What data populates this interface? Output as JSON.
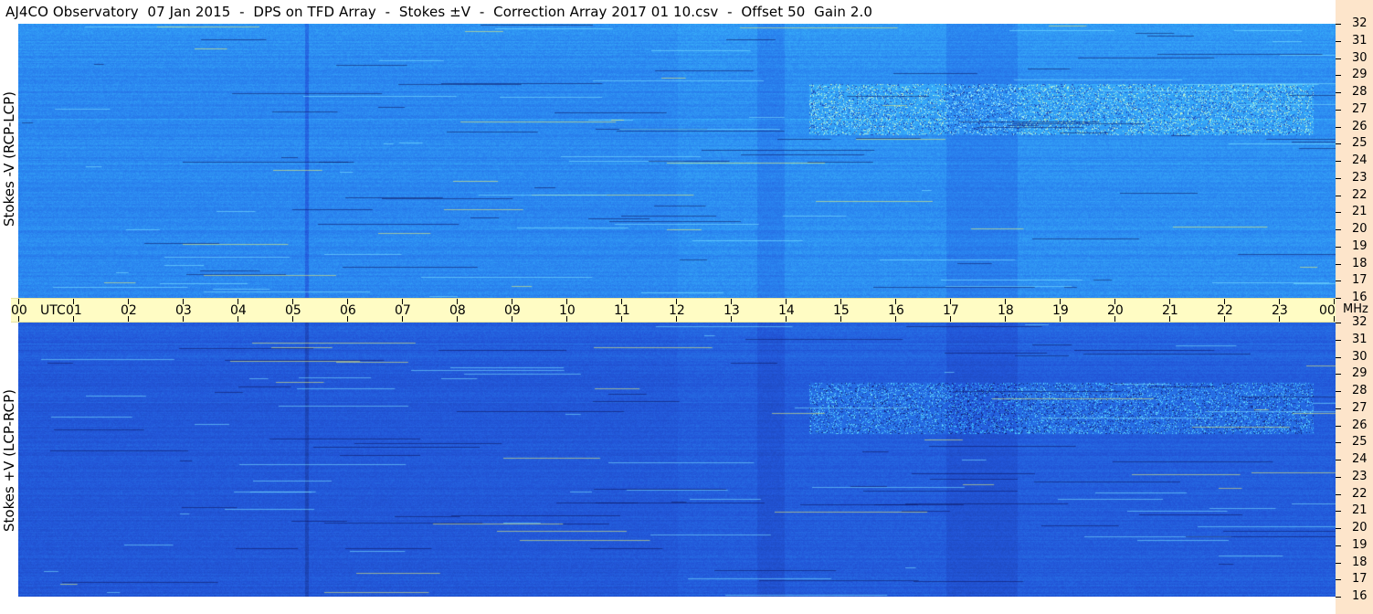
{
  "title": "AJ4CO Observatory  07 Jan 2015  -  DPS on TFD Array  -  Stokes ±V  -  Correction Array 2017 01 10.csv  -  Offset 50  Gain 2.0",
  "chart_data": [
    {
      "type": "heatmap",
      "panel": "top",
      "ylabel": "Stokes -V (RCP-LCP)",
      "x_ticks": [
        "00",
        "01",
        "02",
        "03",
        "04",
        "05",
        "06",
        "07",
        "08",
        "09",
        "10",
        "11",
        "12",
        "13",
        "14",
        "15",
        "16",
        "17",
        "18",
        "19",
        "20",
        "21",
        "22",
        "23",
        "00"
      ],
      "x_unit_label": "UTC",
      "x_range_hours": [
        0,
        24
      ],
      "y_ticks": [
        "32",
        "31",
        "30",
        "29",
        "28",
        "27",
        "26",
        "25",
        "24",
        "23",
        "22",
        "21",
        "20",
        "19",
        "18",
        "17",
        "16"
      ],
      "y_unit": "MHz",
      "y_range_mhz": [
        16,
        32
      ],
      "colormap": [
        "#101a6e",
        "#1a3ea8",
        "#2255d8",
        "#2a86f0",
        "#41c8ff",
        "#9ff0ff",
        "#f6f86a"
      ],
      "background_level": "medium blue"
    },
    {
      "type": "heatmap",
      "panel": "bottom",
      "ylabel": "Stokes +V (LCP-RCP)",
      "x_ticks": [
        "00",
        "01",
        "02",
        "03",
        "04",
        "05",
        "06",
        "07",
        "08",
        "09",
        "10",
        "11",
        "12",
        "13",
        "14",
        "15",
        "16",
        "17",
        "18",
        "19",
        "20",
        "21",
        "22",
        "23",
        "00"
      ],
      "x_unit_label": "UTC",
      "x_range_hours": [
        0,
        24
      ],
      "y_ticks": [
        "32",
        "31",
        "30",
        "29",
        "28",
        "27",
        "26",
        "25",
        "24",
        "23",
        "22",
        "21",
        "20",
        "19",
        "18",
        "17",
        "16"
      ],
      "y_unit": "MHz",
      "y_range_mhz": [
        16,
        32
      ],
      "colormap": [
        "#101a6e",
        "#1a3ea8",
        "#2255d8",
        "#2a86f0",
        "#41c8ff",
        "#9ff0ff",
        "#f6f86a"
      ],
      "background_level": "darker blue"
    }
  ]
}
